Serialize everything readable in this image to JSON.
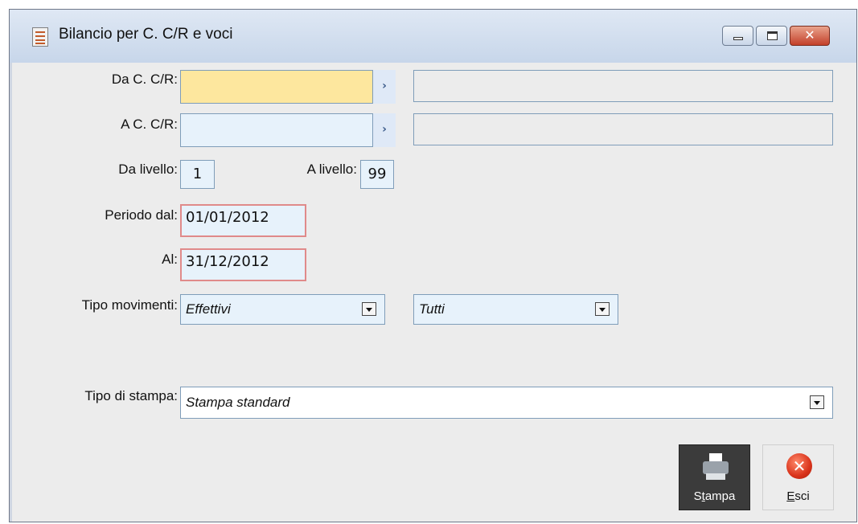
{
  "window": {
    "title": "Bilancio per C. C/R e voci"
  },
  "form": {
    "da_ccr": {
      "label": "Da C. C/R:",
      "value": "",
      "desc": ""
    },
    "a_ccr": {
      "label": "A C. C/R:",
      "value": "",
      "desc": ""
    },
    "da_livello": {
      "label": "Da livello:",
      "value": "1"
    },
    "a_livello": {
      "label": "A livello:",
      "value": "99"
    },
    "periodo_dal": {
      "label": "Periodo dal:",
      "value": "01/01/2012"
    },
    "al": {
      "label": "Al:",
      "value": "31/12/2012"
    },
    "tipo_movimenti": {
      "label": "Tipo movimenti:",
      "value1": "Effettivi",
      "value2": "Tutti"
    },
    "tipo_stampa": {
      "label": "Tipo di stampa:",
      "value": "Stampa standard"
    }
  },
  "buttons": {
    "stampa": {
      "first": "S",
      "underlined": "t",
      "rest": "ampa"
    },
    "esci": {
      "underlined": "E",
      "rest": "sci"
    }
  },
  "icons": {
    "app": "form-icon",
    "zoom": "chevron-right-icon",
    "dropdown": "chevron-down-icon",
    "print": "printer-icon",
    "exit": "close-circle-icon"
  },
  "colors": {
    "field_bg": "#e7f2fb",
    "focused_field_bg": "#fde79e",
    "required_border": "#e08a8a",
    "stampa_bg": "#3b3b3b",
    "exit_icon": "#d9331b"
  }
}
